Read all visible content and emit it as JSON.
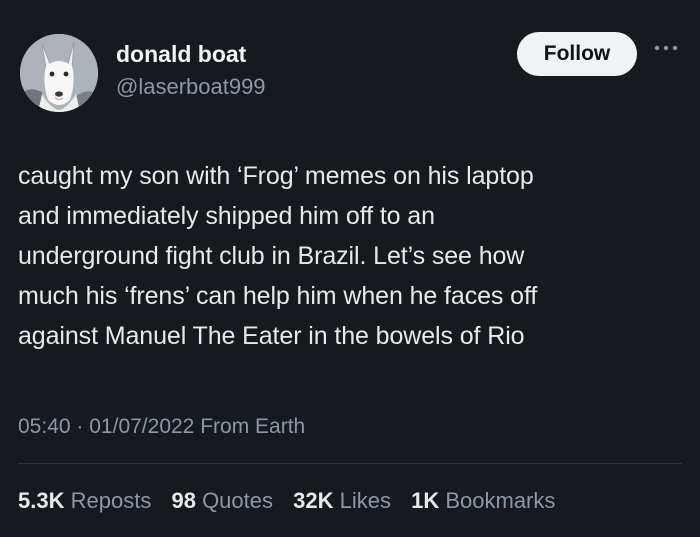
{
  "author": {
    "display_name": "donald boat",
    "handle": "@laserboat999",
    "avatar_icon": "bull-terrier-avatar"
  },
  "header": {
    "follow_label": "Follow",
    "more_icon": "more-dots-icon"
  },
  "tweet": {
    "text": "caught my son with ‘Frog’ memes on his laptop\nand immediately shipped him off to an\nunderground fight club in Brazil. Let’s see how\nmuch his ‘frens’ can help him when he faces off\nagainst Manuel The Eater in the bowels of Rio",
    "time": "05:40",
    "separator": "·",
    "date": "01/07/2022",
    "source": "From Earth"
  },
  "stats": [
    {
      "value": "5.3K",
      "label": "Reposts"
    },
    {
      "value": "98",
      "label": "Quotes"
    },
    {
      "value": "32K",
      "label": "Likes"
    },
    {
      "value": "1K",
      "label": "Bookmarks"
    }
  ],
  "colors": {
    "background": "#161a1f",
    "primary_text": "#e7e9ea",
    "secondary_text": "#8b98a5",
    "follow_bg": "#eff3f4"
  }
}
